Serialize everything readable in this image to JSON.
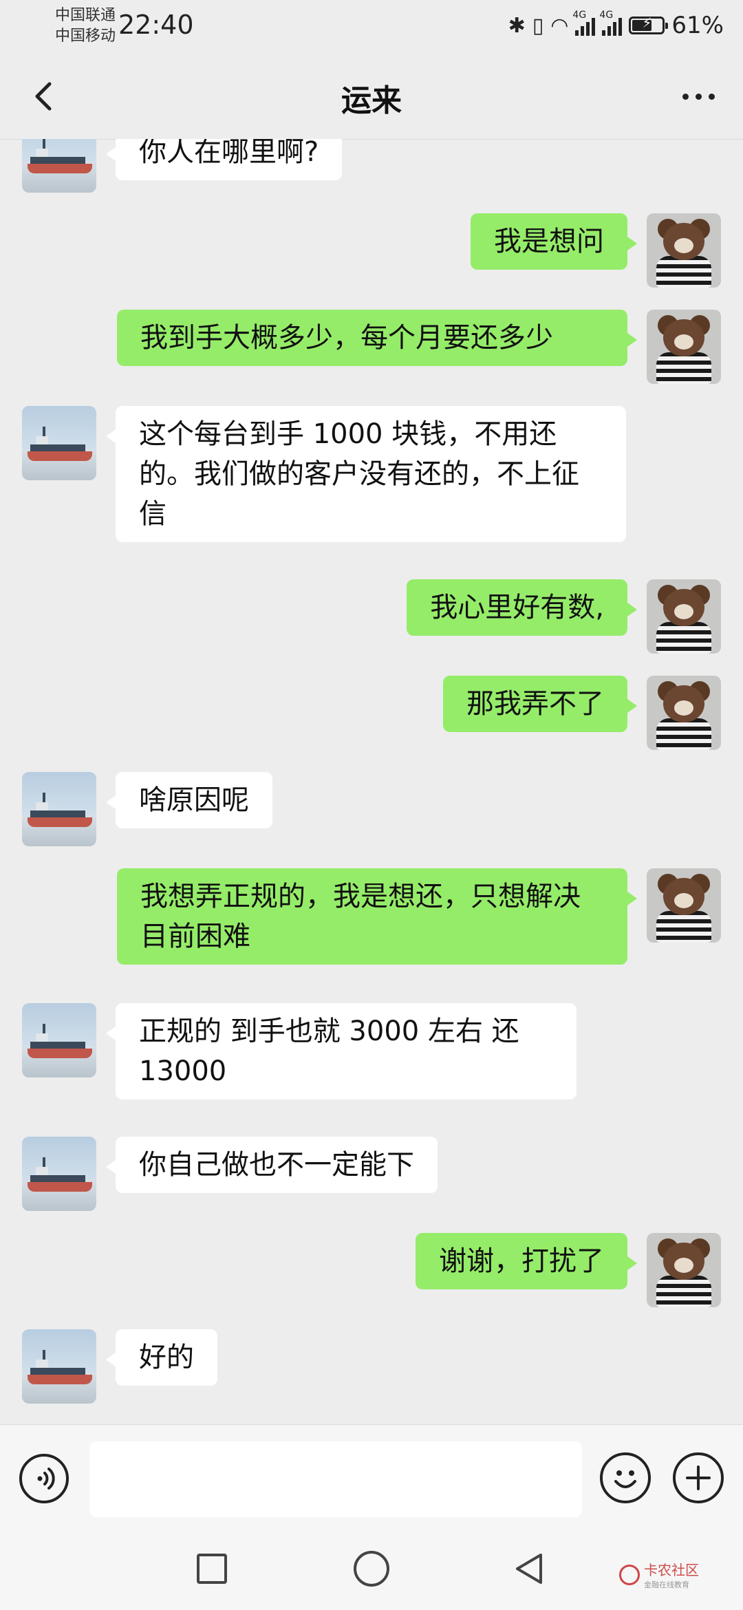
{
  "status_bar": {
    "carrier_1": "中国联通",
    "carrier_2": "中国移动",
    "time": "22:40",
    "battery_percent": "61%",
    "network_tag_1": "4G",
    "network_tag_2": "4G"
  },
  "header": {
    "title": "运来",
    "back_icon": "chevron-left-icon",
    "more_icon": "more-horizontal-icon"
  },
  "messages": [
    {
      "side": "left",
      "text": "你人在哪里啊?"
    },
    {
      "side": "right",
      "text": "我是想问"
    },
    {
      "side": "right",
      "text": "我到手大概多少，每个月要还多少"
    },
    {
      "side": "left",
      "text": "这个每台到手 1000 块钱，不用还的。我们做的客户没有还的，不上征信"
    },
    {
      "side": "right",
      "text": "我心里好有数,"
    },
    {
      "side": "right",
      "text": "那我弄不了"
    },
    {
      "side": "left",
      "text": "啥原因呢"
    },
    {
      "side": "right",
      "text": "我想弄正规的，我是想还，只想解决目前困难"
    },
    {
      "side": "left",
      "text": "正规的 到手也就 3000 左右 还 13000"
    },
    {
      "side": "left",
      "text": "你自己做也不一定能下"
    },
    {
      "side": "right",
      "text": "谢谢，打扰了"
    },
    {
      "side": "left",
      "text": "好的"
    }
  ],
  "input_bar": {
    "voice_icon": "voice-icon",
    "emoji_icon": "emoji-icon",
    "plus_icon": "plus-icon",
    "input_value": ""
  },
  "watermark": {
    "title": "卡农社区",
    "subtitle": "金融在线教育"
  },
  "colors": {
    "background": "#ededed",
    "bubble_sent": "#95ec69",
    "bubble_received": "#ffffff"
  }
}
